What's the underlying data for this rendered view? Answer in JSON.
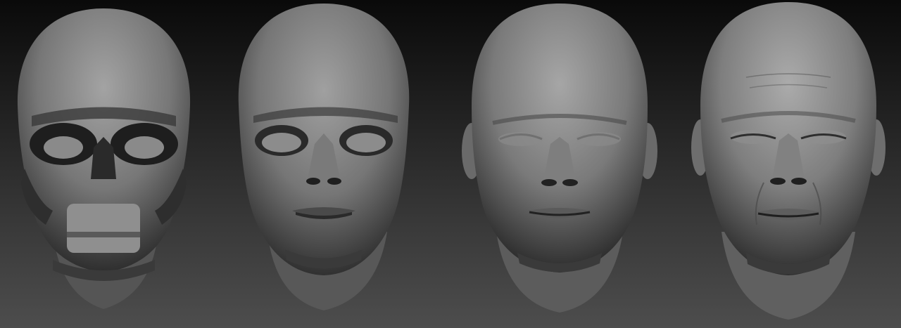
{
  "scene": {
    "background_top": "#0a0a0a",
    "background_bottom": "#4d4d4d",
    "clay_light": "#9a9a9a",
    "clay_mid": "#6e6e6e",
    "clay_dark": "#2a2a2a"
  },
  "heads": [
    {
      "stage": "skull",
      "icon": "skull-blockout-sculpt"
    },
    {
      "stage": "rough-face",
      "icon": "rough-face-sculpt"
    },
    {
      "stage": "refined-face",
      "icon": "refined-face-sculpt"
    },
    {
      "stage": "detailed-face",
      "icon": "detailed-face-sculpt"
    }
  ]
}
